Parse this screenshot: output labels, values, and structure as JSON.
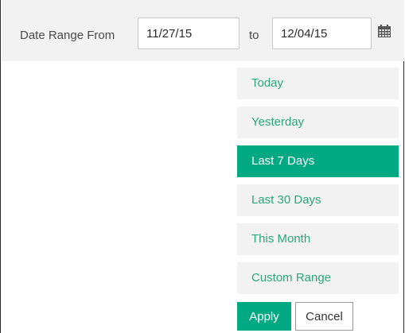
{
  "date_range": {
    "from_label": "Date Range From",
    "from_value": "11/27/15",
    "to_label": "to",
    "to_value": "12/04/15",
    "calendar_icon": "calendar-icon"
  },
  "ranges": [
    {
      "label": "Today",
      "active": false
    },
    {
      "label": "Yesterday",
      "active": false
    },
    {
      "label": "Last 7 Days",
      "active": true
    },
    {
      "label": "Last 30 Days",
      "active": false
    },
    {
      "label": "This Month",
      "active": false
    },
    {
      "label": "Custom Range",
      "active": false
    }
  ],
  "buttons": {
    "apply": "Apply",
    "cancel": "Cancel"
  },
  "colors": {
    "accent": "#01a982",
    "link": "#2aa57d",
    "toolbar_bg": "#f2f2f2"
  }
}
